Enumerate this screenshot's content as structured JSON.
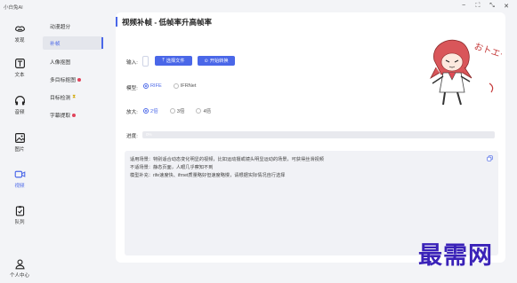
{
  "app": {
    "title": "小白兔AI"
  },
  "window_controls": [
    "minimize",
    "maximize",
    "restore",
    "close"
  ],
  "rail": [
    {
      "label": "发现",
      "icon": "discover-icon"
    },
    {
      "label": "文本",
      "icon": "text-icon"
    },
    {
      "label": "音频",
      "icon": "headphones-icon"
    },
    {
      "label": "图片",
      "icon": "image-icon"
    },
    {
      "label": "视频",
      "icon": "video-icon",
      "active": true
    },
    {
      "label": "队列",
      "icon": "clipboard-icon"
    },
    {
      "label": "个人中心",
      "icon": "user-icon"
    }
  ],
  "subnav": [
    {
      "label": "动漫超分"
    },
    {
      "label": "补帧",
      "active": true
    },
    {
      "label": "人像抠图"
    },
    {
      "label": "多目标抠图",
      "badge": "dot"
    },
    {
      "label": "目标检测",
      "badge": "hourglass"
    },
    {
      "label": "字幕提取",
      "badge": "dot"
    }
  ],
  "main": {
    "title": "视频补帧 - 低帧率升高帧率",
    "input_label": "输入:",
    "select_file_label": "选择文件",
    "start_convert_label": "开始转换",
    "model_label": "模型:",
    "model_options": [
      "RIFE",
      "IFRNet"
    ],
    "model_selected": "RIFE",
    "scale_label": "放大:",
    "scale_options": [
      "2倍",
      "3倍",
      "4倍"
    ],
    "scale_selected": "2倍",
    "progress_label": "进度:",
    "progress_text": "0%",
    "progress_value": 0,
    "info": {
      "line1": "适用场景：特别适合动态变化明显的视频，比如运动摄或镜头明显运动的场景，可获得丝滑视频",
      "line2": "不适场景：静态页面，人眼几乎察知不到",
      "line3": "模型补充：rife速度快、ifrnet质量略好但速度略慢，请根据实际情况自行选择"
    }
  },
  "mascot_text": "おトエーレ",
  "watermark": "最需网",
  "colors": {
    "accent": "#4a67e8",
    "badge_red": "#e0435a",
    "watermark": "#3a22b8"
  }
}
